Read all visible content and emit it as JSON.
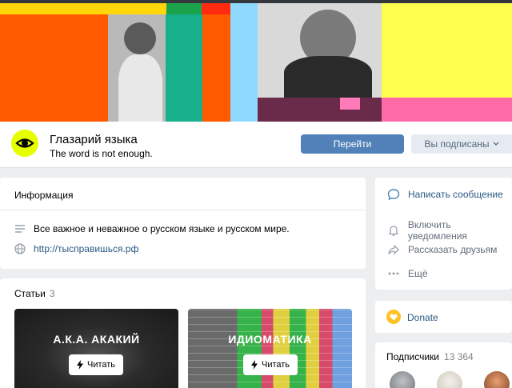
{
  "group": {
    "name": "Глазарий языка",
    "status": "The word is not enough."
  },
  "buttons": {
    "go": "Перейти",
    "subscribed": "Вы подписаны"
  },
  "info": {
    "heading": "Информация",
    "description": "Все важное и неважное о русском языке и русском мире.",
    "website": "http://тысправишься.рф"
  },
  "actions": [
    {
      "label": "Написать сообщение",
      "icon": "message-icon"
    },
    {
      "label": "Включить уведомления",
      "icon": "bell-icon"
    },
    {
      "label": "Рассказать друзьям",
      "icon": "share-icon"
    },
    {
      "label": "Ещё",
      "icon": "more-icon"
    }
  ],
  "donate": {
    "label": "Donate",
    "icon": "heart-icon"
  },
  "subscribers": {
    "heading": "Подписчики",
    "count": "13 364"
  },
  "articles": {
    "heading": "Статьи",
    "count": "3",
    "items": [
      {
        "title": "А.К.А. АКАКИЙ",
        "button": "Читать"
      },
      {
        "title": "ИДИОМАТИКА",
        "button": "Читать"
      }
    ]
  },
  "colors": {
    "accent": "#5181b8",
    "link": "#2a5885",
    "logo_bg": "#e6ff00",
    "donate": "#ffc225"
  }
}
